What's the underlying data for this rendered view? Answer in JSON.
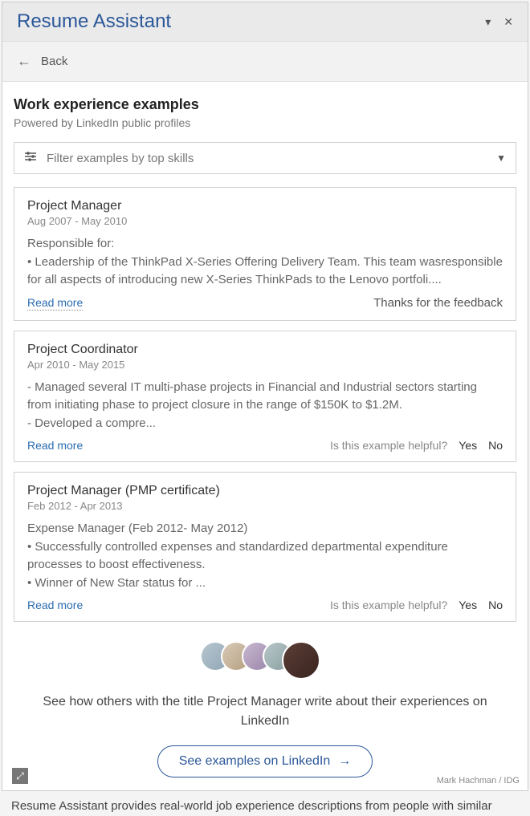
{
  "titlebar": {
    "title": "Resume Assistant"
  },
  "backbar": {
    "label": "Back"
  },
  "section": {
    "title": "Work experience examples",
    "subtitle": "Powered by LinkedIn public profiles"
  },
  "filter": {
    "placeholder": "Filter examples by top skills"
  },
  "examples": [
    {
      "title": "Project Manager",
      "dates": "Aug 2007 - May 2010",
      "body": "Responsible for:\n• Leadership of the ThinkPad X-Series Offering Delivery Team. This team wasresponsible for all aspects of introducing new X-Series ThinkPads to the Lenovo portfoli....",
      "read_more": "Read more",
      "feedback_thanks": "Thanks for the feedback"
    },
    {
      "title": "Project Coordinator",
      "dates": "Apr 2010 - May 2015",
      "body": "- Managed several IT multi-phase projects in Financial and Industrial sectors starting from initiating phase to project closure in the range of $150K to $1.2M.\n- Developed a compre...",
      "read_more": "Read more",
      "helpful_q": "Is this example helpful?",
      "yes": "Yes",
      "no": "No"
    },
    {
      "title": "Project Manager (PMP certificate)",
      "dates": "Feb 2012 - Apr 2013",
      "body": "Expense Manager (Feb 2012- May 2012)\n• Successfully controlled expenses and standardized departmental expenditure processes to boost effectiveness.\n• Winner of New Star status for ...",
      "read_more": "Read more",
      "helpful_q": "Is this example helpful?",
      "yes": "Yes",
      "no": "No"
    }
  ],
  "linkedin": {
    "see_how": "See how others with the title Project Manager write about their experiences on LinkedIn",
    "button": "See examples on LinkedIn"
  },
  "credit": "Mark Hachman / IDG",
  "caption": "Resume Assistant provides real-world job experience descriptions from people with similar"
}
